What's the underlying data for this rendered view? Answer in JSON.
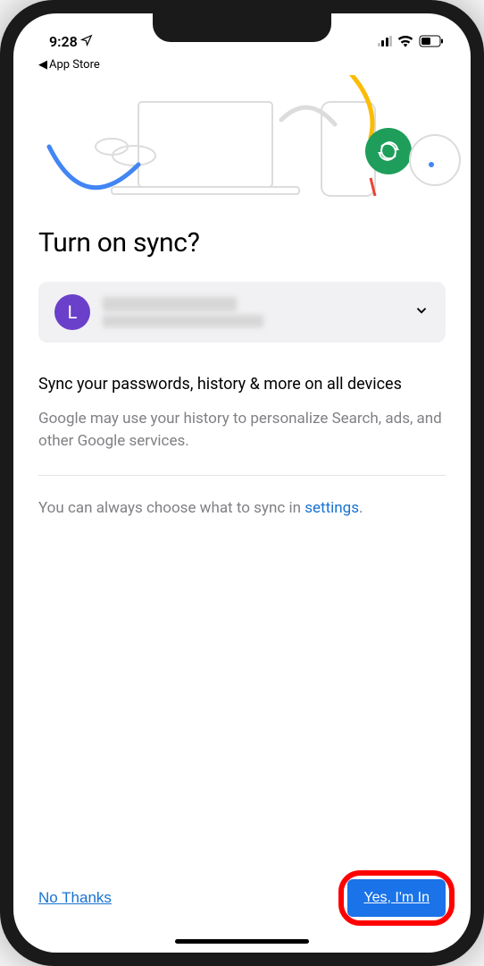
{
  "statusBar": {
    "time": "9:28",
    "locationIcon": "location-arrow",
    "backLabel": "App Store"
  },
  "page": {
    "heading": "Turn on sync?",
    "account": {
      "avatarLetter": "L"
    },
    "descTitle": "Sync your passwords, history & more on all devices",
    "descSub": "Google may use your history to personalize Search, ads, and other Google services.",
    "settingsPrefix": "You can always choose what to sync in ",
    "settingsLink": "settings",
    "settingsSuffix": "."
  },
  "footer": {
    "noThanks": "No Thanks",
    "yesImIn": "Yes, I'm In"
  }
}
